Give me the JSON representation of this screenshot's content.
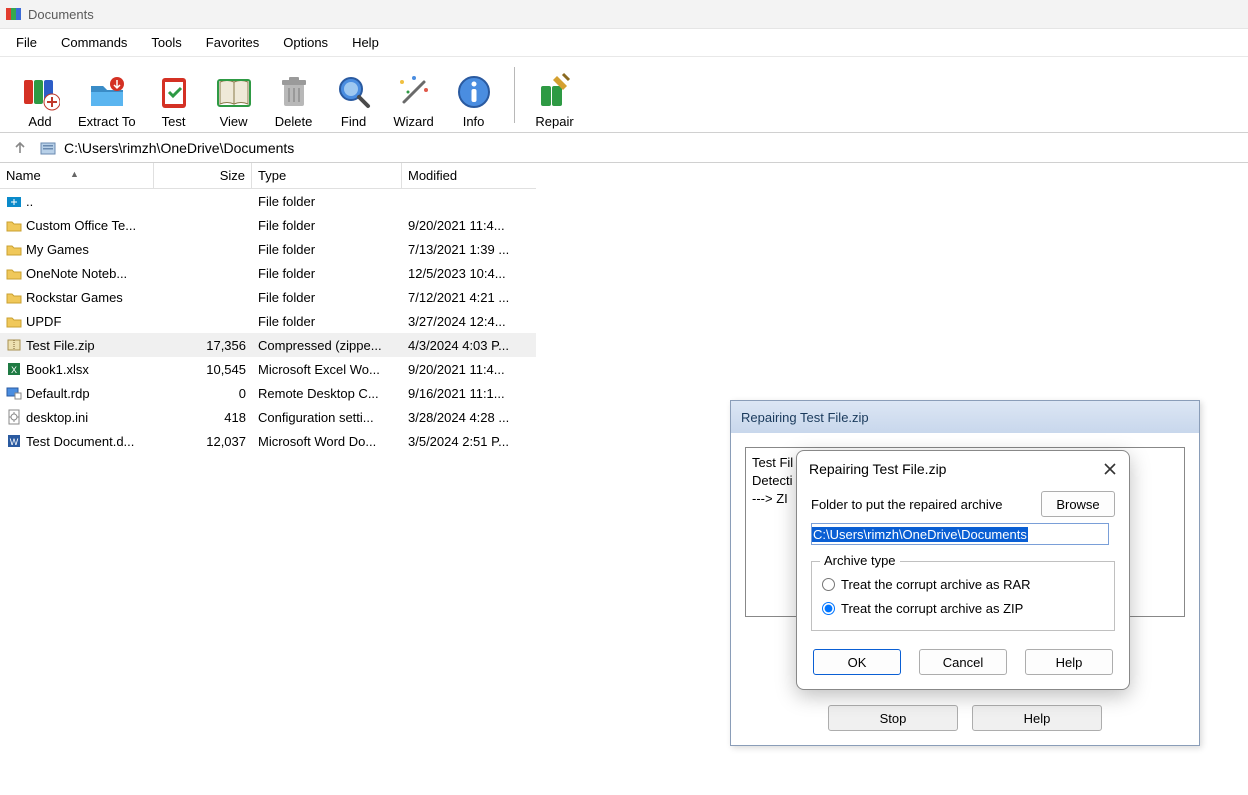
{
  "window": {
    "title": "Documents"
  },
  "menu": {
    "file": "File",
    "commands": "Commands",
    "tools": "Tools",
    "favorites": "Favorites",
    "options": "Options",
    "help": "Help"
  },
  "toolbar": {
    "add": "Add",
    "extract": "Extract To",
    "test": "Test",
    "view": "View",
    "delete": "Delete",
    "find": "Find",
    "wizard": "Wizard",
    "info": "Info",
    "repair": "Repair"
  },
  "pathbar": {
    "path": "C:\\Users\\rimzh\\OneDrive\\Documents"
  },
  "columns": {
    "name": "Name",
    "size": "Size",
    "type": "Type",
    "modified": "Modified"
  },
  "rows": [
    {
      "icon": "up",
      "name": "..",
      "size": "",
      "type": "File folder",
      "mod": ""
    },
    {
      "icon": "folder",
      "name": "Custom Office Te...",
      "size": "",
      "type": "File folder",
      "mod": "9/20/2021 11:4..."
    },
    {
      "icon": "folder",
      "name": "My Games",
      "size": "",
      "type": "File folder",
      "mod": "7/13/2021 1:39 ..."
    },
    {
      "icon": "folder",
      "name": "OneNote Noteb...",
      "size": "",
      "type": "File folder",
      "mod": "12/5/2023 10:4..."
    },
    {
      "icon": "folder",
      "name": "Rockstar Games",
      "size": "",
      "type": "File folder",
      "mod": "7/12/2021 4:21 ..."
    },
    {
      "icon": "folder",
      "name": "UPDF",
      "size": "",
      "type": "File folder",
      "mod": "3/27/2024 12:4..."
    },
    {
      "icon": "zip",
      "name": "Test File.zip",
      "size": "17,356",
      "type": "Compressed (zippe...",
      "mod": "4/3/2024 4:03 P...",
      "selected": true
    },
    {
      "icon": "xlsx",
      "name": "Book1.xlsx",
      "size": "10,545",
      "type": "Microsoft Excel Wo...",
      "mod": "9/20/2021 11:4..."
    },
    {
      "icon": "rdp",
      "name": "Default.rdp",
      "size": "0",
      "type": "Remote Desktop C...",
      "mod": "9/16/2021 11:1..."
    },
    {
      "icon": "ini",
      "name": "desktop.ini",
      "size": "418",
      "type": "Configuration setti...",
      "mod": "3/28/2024 4:28 ..."
    },
    {
      "icon": "docx",
      "name": "Test Document.d...",
      "size": "12,037",
      "type": "Microsoft Word Do...",
      "mod": "3/5/2024 2:51 P..."
    }
  ],
  "dialog_back": {
    "title": "Repairing Test File.zip",
    "log_line1": "Test Fil",
    "log_line2": "Detecti",
    "log_line3": "---> ZI",
    "stop": "Stop",
    "help": "Help"
  },
  "dialog_front": {
    "title": "Repairing Test File.zip",
    "folder_label": "Folder to put the repaired archive",
    "browse": "Browse",
    "path_value": "C:\\Users\\rimzh\\OneDrive\\Documents",
    "group_label": "Archive type",
    "radio_rar": "Treat the corrupt archive as RAR",
    "radio_zip": "Treat the corrupt archive as ZIP",
    "ok": "OK",
    "cancel": "Cancel",
    "help": "Help"
  }
}
